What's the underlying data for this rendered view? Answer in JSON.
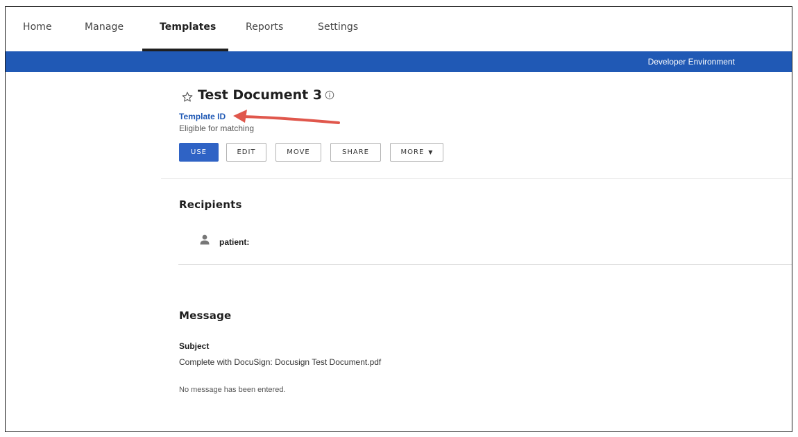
{
  "nav": {
    "items": [
      {
        "label": "Home"
      },
      {
        "label": "Manage"
      },
      {
        "label": "Templates",
        "active": true
      },
      {
        "label": "Reports"
      },
      {
        "label": "Settings"
      }
    ]
  },
  "envbar": {
    "label": "Developer Environment",
    "color": "#2059b5"
  },
  "template": {
    "title": "Test Document 3",
    "star_icon": "star-outline-icon",
    "info_icon": "info-circle-icon",
    "id_link": "Template ID",
    "status": "Eligible for matching"
  },
  "annotation": {
    "arrow_color": "#e0574c"
  },
  "actions": {
    "use": "USE",
    "edit": "EDIT",
    "move": "MOVE",
    "share": "SHARE",
    "more": "MORE",
    "more_caret": "▼"
  },
  "recipients": {
    "title": "Recipients",
    "items": [
      {
        "name": "patient:",
        "icon": "person-icon"
      }
    ]
  },
  "message": {
    "title": "Message",
    "subject_label": "Subject",
    "subject_value": "Complete with DocuSign: Docusign Test Document.pdf",
    "body": "No message has been entered."
  }
}
